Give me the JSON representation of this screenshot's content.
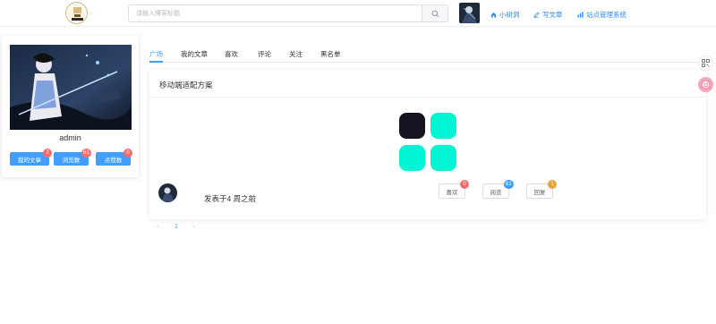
{
  "header": {
    "logo_icon": "book-logo-icon",
    "search": {
      "placeholder": "请输入博客标题",
      "value": ""
    },
    "nav": [
      {
        "label": "小树洞",
        "icon": "home-icon"
      },
      {
        "label": "写文章",
        "icon": "edit-icon"
      },
      {
        "label": "站点管理系统",
        "icon": "bar-chart-icon"
      }
    ]
  },
  "profile": {
    "username": "admin",
    "stats": [
      {
        "label": "我的文章",
        "count": "2",
        "badge_color": "#f56c6c"
      },
      {
        "label": "浏览数",
        "count": "61",
        "badge_color": "#f56c6c"
      },
      {
        "label": "点赞数",
        "count": "0",
        "badge_color": "#f56c6c"
      }
    ]
  },
  "tabs": [
    {
      "label": "广场",
      "active": true
    },
    {
      "label": "我的文章",
      "active": false
    },
    {
      "label": "喜欢",
      "active": false
    },
    {
      "label": "评论",
      "active": false
    },
    {
      "label": "关注",
      "active": false
    },
    {
      "label": "黑名单",
      "active": false
    }
  ],
  "post": {
    "title": "移动端适配方案",
    "time": "发表于4 周之前",
    "actions": [
      {
        "label": "喜欢",
        "count": "0",
        "badge_color": "#f56c6c"
      },
      {
        "label": "阅览",
        "count": "61",
        "badge_color": "#409eff"
      },
      {
        "label": "回复",
        "count": "1",
        "badge_color": "#e6a23c"
      }
    ],
    "image_colors": [
      "#141421",
      "#00f5d4",
      "#00f5d4",
      "#00f5d4"
    ]
  },
  "pagination": {
    "prev": "‹",
    "current": "1",
    "next": "›"
  },
  "colors": {
    "accent": "#409eff",
    "danger": "#f56c6c",
    "warning": "#e6a23c"
  }
}
